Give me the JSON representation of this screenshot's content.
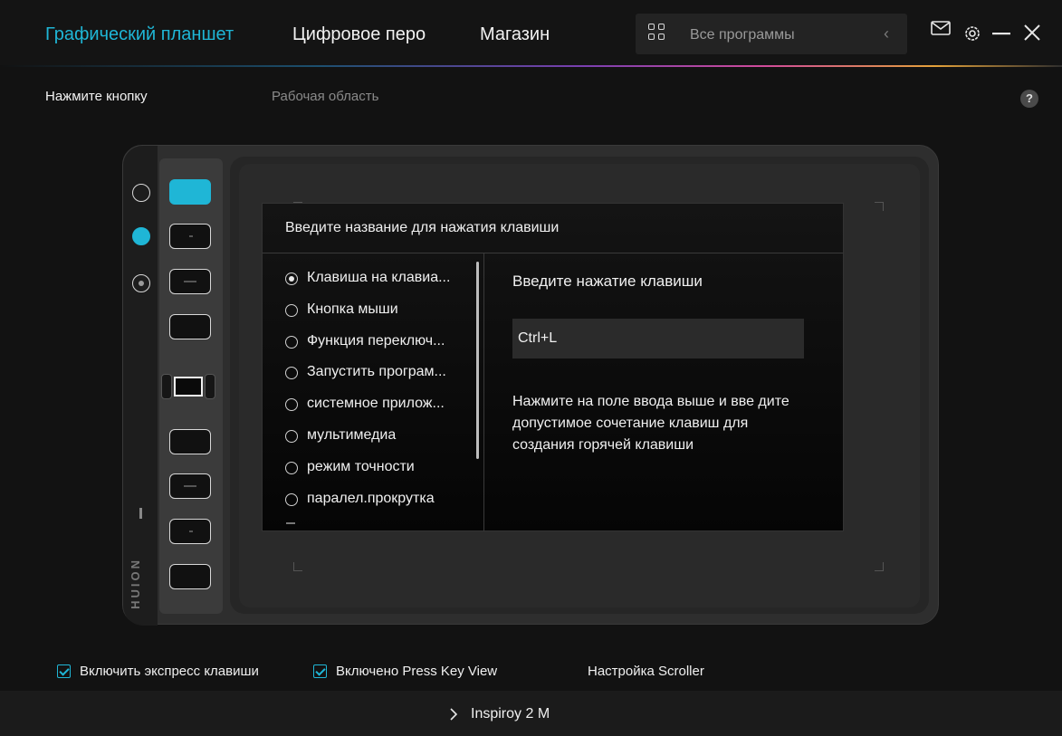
{
  "topbar": {
    "tabs": [
      {
        "label": "Графический планшет",
        "active": true
      },
      {
        "label": "Цифровое перо",
        "active": false
      },
      {
        "label": "Магазин",
        "active": false
      }
    ],
    "search": {
      "text": "Все программы",
      "icon": "grid-icon"
    },
    "icons": [
      "mail-icon",
      "settings-icon",
      "minimize-icon",
      "close-icon"
    ]
  },
  "subtabs": [
    {
      "label": "Нажмите кнопку",
      "active": true
    },
    {
      "label": "Рабочая область",
      "active": false
    }
  ],
  "help_label": "?",
  "device": {
    "side_buttons_selected": 2,
    "hotkeys_selected": 1,
    "brand": "HUION"
  },
  "dialog": {
    "title": "Введите название для нажатия клавиши",
    "options": [
      {
        "label": "Клавиша на клавиа...",
        "checked": true
      },
      {
        "label": "Кнопка мыши",
        "checked": false
      },
      {
        "label": "Функция переключ...",
        "checked": false
      },
      {
        "label": "Запустить програм...",
        "checked": false
      },
      {
        "label": "системное прилож...",
        "checked": false
      },
      {
        "label": "мультимедиа",
        "checked": false
      },
      {
        "label": "режим точности",
        "checked": false
      },
      {
        "label": "паралел.прокрутка",
        "checked": false
      }
    ],
    "input_label": "Введите нажатие клавиши",
    "input_value": "Ctrl+L",
    "hint": "Нажмите на поле ввода выше и вве дите допустимое сочетание клавиш для создания горячей клавиши"
  },
  "bottom": {
    "checkbox1": {
      "label": "Включить экспресс клавиши",
      "checked": true
    },
    "checkbox2": {
      "label": "Включено Press Key View",
      "checked": true
    },
    "scroller_label": "Настройка Scroller"
  },
  "footer": {
    "device_name": "Inspiroy 2 M",
    "chevron": "chevron-right-icon"
  },
  "colors": {
    "accent": "#1fb6d6",
    "background": "#121212"
  }
}
